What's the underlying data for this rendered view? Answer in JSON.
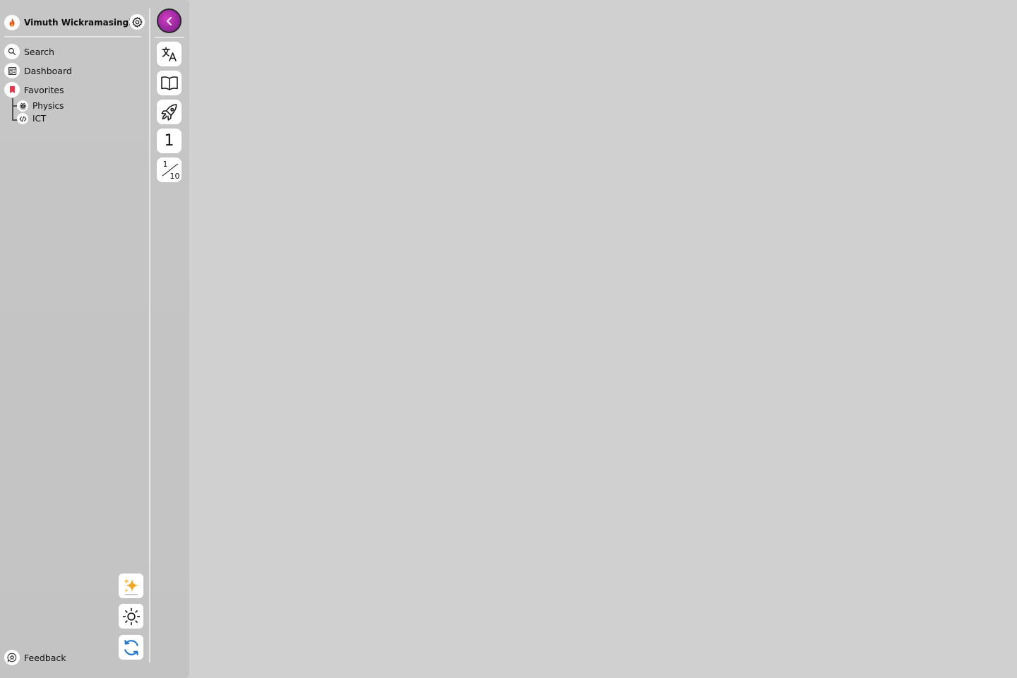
{
  "profile": {
    "name": "Vimuth Wickramasinghe"
  },
  "nav": {
    "search": "Search",
    "dashboard": "Dashboard",
    "favorites": "Favorites"
  },
  "favorites": {
    "items": [
      "Physics",
      "ICT"
    ]
  },
  "rail": {
    "number_label": "1",
    "fraction": {
      "numerator": "1",
      "denominator": "10"
    }
  },
  "footer": {
    "feedback": "Feedback"
  },
  "colors": {
    "background": "#d0d0d0",
    "sidebar": "#c4c4c4",
    "accent_purple": "#9b2aa0",
    "fire": "#e8501c",
    "bookmark": "#e8344a",
    "refresh": "#1f78d1",
    "sparkle": "#f5a623"
  },
  "icons": {
    "profile": "fire-icon",
    "settings": "gear-icon",
    "search": "magnifier-icon",
    "dashboard": "dashboard-icon",
    "favorites": "bookmark-icon",
    "physics": "atom-icon",
    "ict": "code-icon",
    "collapse": "chevron-left-icon",
    "translate": "translate-icon",
    "book": "book-icon",
    "rocket": "rocket-icon",
    "ai": "sparkles-icon",
    "theme": "sun-icon",
    "sync": "refresh-icon",
    "feedback": "feedback-icon"
  }
}
